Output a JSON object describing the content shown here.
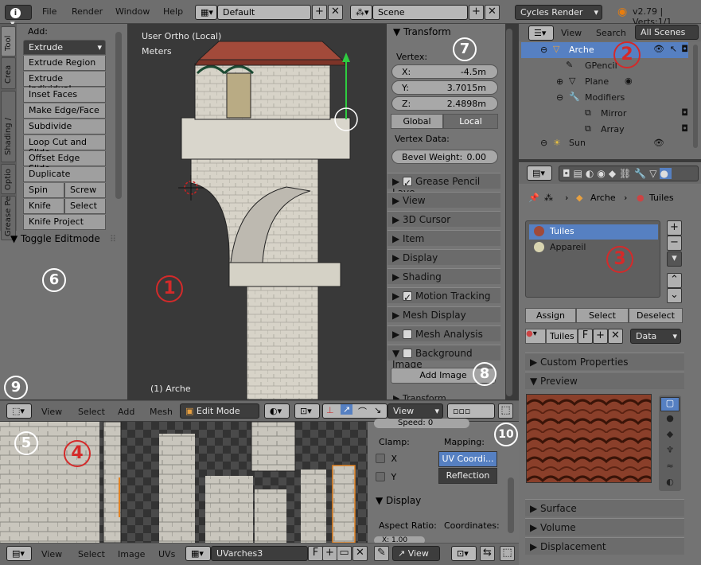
{
  "topbar": {
    "menus": [
      "File",
      "Render",
      "Window",
      "Help"
    ],
    "layout": "Default",
    "scene": "Scene",
    "engine": "Cycles Render",
    "version": "v2.79 | Verts:1/1"
  },
  "toolshelf": {
    "tabs": [
      "Tool",
      "Crea",
      "Shading /",
      "Optio",
      "Grease Pe"
    ],
    "add_label": "Add:",
    "extrude_dropdown": "Extrude",
    "tools": [
      "Extrude Region",
      "Extrude Individual",
      "Inset Faces",
      "Make Edge/Face",
      "Subdivide",
      "Loop Cut and Slide",
      "Offset Edge Slide",
      "Duplicate"
    ],
    "spin": "Spin",
    "screw": "Screw",
    "knife": "Knife",
    "select": "Select",
    "knife_project": "Knife Project",
    "toggle_editmode": "Toggle Editmode"
  },
  "viewport": {
    "view_name": "User Ortho (Local)",
    "units": "Meters",
    "object_label": "(1) Arche"
  },
  "npanel": {
    "transform": "Transform",
    "vertex_label": "Vertex:",
    "x": "X:",
    "x_val": "-4.5m",
    "y": "Y:",
    "y_val": "3.7015m",
    "z": "Z:",
    "z_val": "2.4898m",
    "global": "Global",
    "local": "Local",
    "vertex_data": "Vertex Data:",
    "bevel_weight": "Bevel Weight:",
    "bevel_val": "0.00",
    "sections": [
      "Grease Pencil Laye",
      "View",
      "3D Cursor",
      "Item",
      "Display",
      "Shading",
      "Motion Tracking",
      "Mesh Display",
      "Mesh Analysis",
      "Background Image"
    ],
    "add_image": "Add Image",
    "transform_orientations": "Transform Orientations"
  },
  "view3d_header": {
    "menus": [
      "View",
      "Select",
      "Add",
      "Mesh"
    ],
    "mode": "Edit Mode",
    "view_dd": "View"
  },
  "uv_side": {
    "speed": "Speed: 0",
    "clamp": "Clamp:",
    "mapping": "Mapping:",
    "x": "X",
    "y": "Y",
    "uv_coord": "UV Coordi...",
    "reflection": "Reflection",
    "display": "Display",
    "aspect_ratio": "Aspect Ratio:",
    "coordinates": "Coordinates:",
    "x_val": "X: 1.00"
  },
  "uv_header": {
    "menus": [
      "View",
      "Select",
      "Image",
      "UVs"
    ],
    "image_name": "UVarches3",
    "f": "F",
    "view_dd": "View"
  },
  "outliner": {
    "view": "View",
    "search": "Search",
    "all_scenes": "All Scenes",
    "rows": [
      "Arche",
      "GPencil",
      "Plane",
      "Modifiers",
      "Mirror",
      "Array",
      "Sun"
    ]
  },
  "properties": {
    "breadcrumb_obj": "Arche",
    "breadcrumb_mat": "Tuiles",
    "materials": [
      "Tuiles",
      "Appareil"
    ],
    "assign": "Assign",
    "select": "Select",
    "deselect": "Deselect",
    "mat_name": "Tuiles",
    "f": "F",
    "data": "Data",
    "sections": [
      "Custom Properties",
      "Preview",
      "Surface",
      "Volume",
      "Displacement"
    ]
  },
  "annotations": [
    "1",
    "2",
    "3",
    "4",
    "5",
    "6",
    "7",
    "8",
    "9",
    "10"
  ],
  "colors": {
    "selected_blue": "#5680c2",
    "header": "#6a6a6a",
    "annotation_red": "#d42a2a"
  }
}
